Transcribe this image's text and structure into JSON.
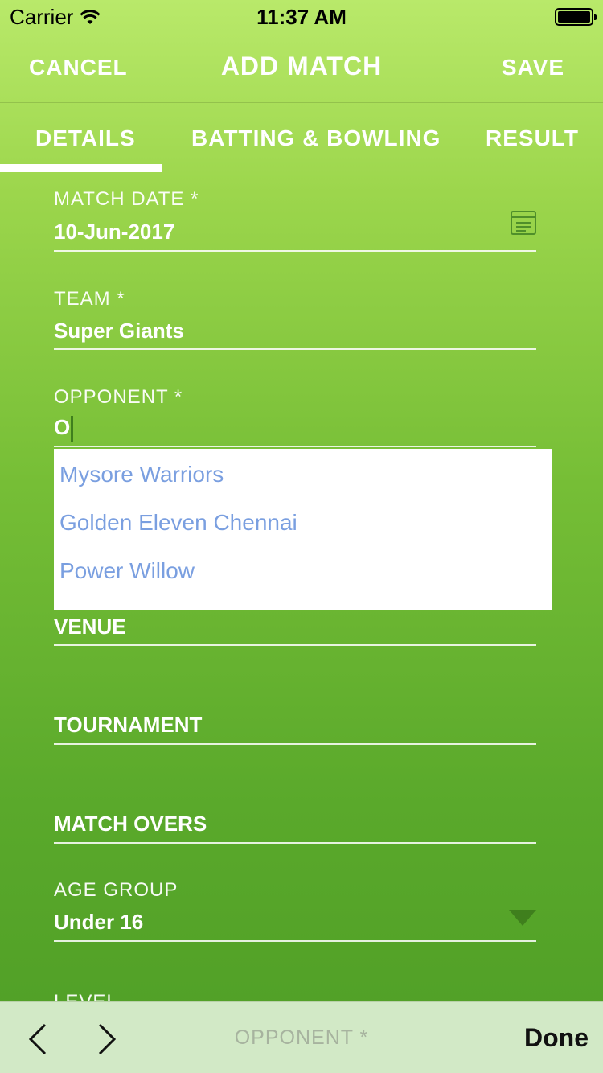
{
  "status_bar": {
    "carrier": "Carrier",
    "time": "11:37 AM"
  },
  "nav": {
    "cancel": "CANCEL",
    "title": "ADD MATCH",
    "save": "SAVE"
  },
  "tabs": [
    {
      "label": "DETAILS",
      "active": true
    },
    {
      "label": "BATTING & BOWLING",
      "active": false
    },
    {
      "label": "RESULT",
      "active": false
    }
  ],
  "form": {
    "match_date": {
      "label": "MATCH DATE *",
      "value": "10-Jun-2017"
    },
    "team": {
      "label": "TEAM *",
      "value": "Super Giants"
    },
    "opponent": {
      "label": "OPPONENT *",
      "value": "O"
    },
    "venue": {
      "placeholder": "VENUE"
    },
    "tournament": {
      "placeholder": "TOURNAMENT"
    },
    "match_overs": {
      "placeholder": "MATCH OVERS"
    },
    "age_group": {
      "label": "AGE GROUP",
      "value": "Under 16"
    },
    "level": {
      "label": "LEVEL"
    }
  },
  "suggestions": [
    "Mysore Warriors",
    "Golden Eleven Chennai",
    "Power Willow"
  ],
  "toolbar": {
    "field_label": "OPPONENT *",
    "done": "Done"
  },
  "colors": {
    "accent": "#7ab93a",
    "suggestion_text": "#7a9fe0"
  }
}
